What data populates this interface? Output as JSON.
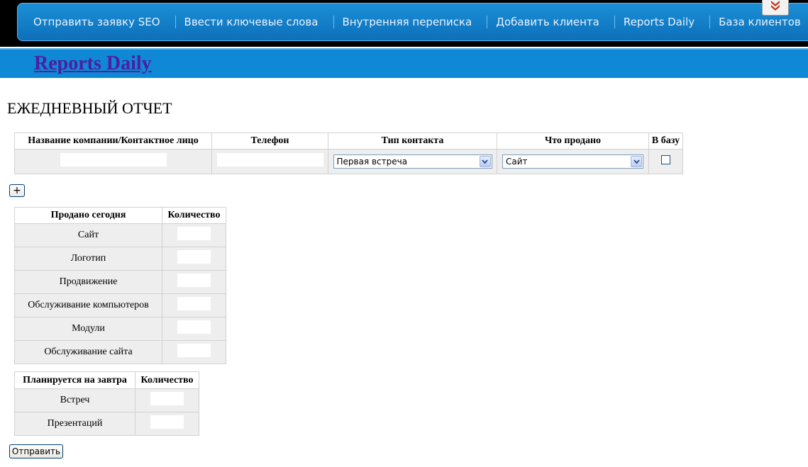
{
  "nav": {
    "items": [
      {
        "label": "Отправить заявку SEO"
      },
      {
        "label": "Ввести ключевые слова"
      },
      {
        "label": "Внутренняя переписка"
      },
      {
        "label": "Добавить клиента"
      },
      {
        "label": "Reports Daily"
      },
      {
        "label": "База клиентов"
      }
    ],
    "download_icon": "download-arrow-icon"
  },
  "header": {
    "site_title": "Reports Daily"
  },
  "page": {
    "heading": "ЕЖЕДНЕВНЫЙ ОТЧЕТ"
  },
  "contacts_table": {
    "headers": [
      "Название компании/Контактное лицо",
      "Телефон",
      "Тип контакта",
      "Что продано",
      "В базу"
    ],
    "row": {
      "company_value": "",
      "phone_value": "",
      "contact_type_selected": "Первая встреча",
      "sold_selected": "Сайт",
      "to_base_checked": false
    }
  },
  "add_row_button": {
    "label": "+"
  },
  "sold_today": {
    "headers": [
      "Продано сегодня",
      "Количество"
    ],
    "rows": [
      {
        "label": "Сайт"
      },
      {
        "label": "Логотип"
      },
      {
        "label": "Продвижение"
      },
      {
        "label": "Обслуживание компьютеров"
      },
      {
        "label": "Модули"
      },
      {
        "label": "Обслуживание сайта"
      }
    ]
  },
  "planned_tomorrow": {
    "headers": [
      "Планируется на завтра",
      "Количество"
    ],
    "rows": [
      {
        "label": "Встреч"
      },
      {
        "label": "Презентаций"
      }
    ]
  },
  "submit_button": {
    "label": "Отправить"
  },
  "colors": {
    "nav_blue": "#0d6fba",
    "header_blue": "#0f88d6",
    "title_purple": "#4b1fa0",
    "download_arrow": "#c0391b"
  }
}
